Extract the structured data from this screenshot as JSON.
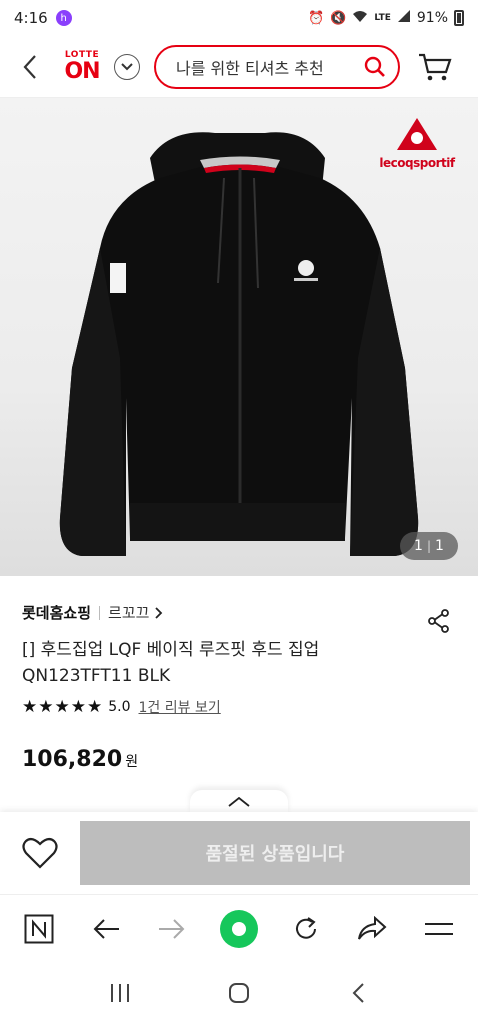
{
  "status_bar": {
    "time": "4:16",
    "battery": "91%",
    "network_label": "LTE",
    "app_badge": "h"
  },
  "header": {
    "logo_top": "LOTTE",
    "logo_main": "ON",
    "search_value": "나를 위한 티셔츠 추천"
  },
  "product_image": {
    "brand_logo_text": "lecoqsportif",
    "current_index": "1",
    "total": "1"
  },
  "product": {
    "seller": "롯데홈쇼핑",
    "brand": "르꼬끄",
    "title": "[] 후드집업 LQF 베이직 루즈핏 후드 집업 QN123TFT11 BLK",
    "rating": "5.0",
    "review_link": "1건 리뷰 보기",
    "price": "106,820",
    "currency": "원"
  },
  "buy_bar": {
    "soldout_label": "품절된 상품입니다"
  },
  "colors": {
    "brand_red": "#e60012",
    "soldout_gray": "#bdbdbd",
    "home_green": "#16c75b"
  },
  "icons": {
    "browser_nav": [
      "naver-n-icon",
      "back-arrow-icon",
      "forward-arrow-icon",
      "home-dot-icon",
      "refresh-icon",
      "share-arrow-icon",
      "menu-icon"
    ],
    "android_nav": [
      "recents-icon",
      "home-icon",
      "back-icon"
    ]
  }
}
